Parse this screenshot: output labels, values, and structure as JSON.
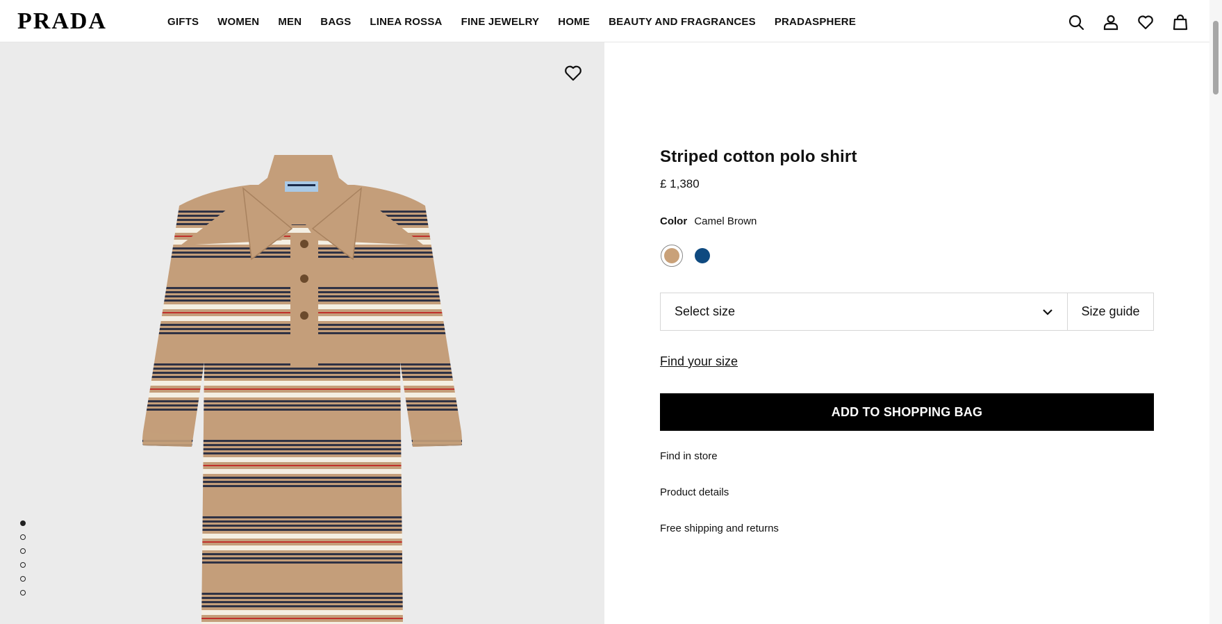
{
  "header": {
    "logo": "PRADA",
    "nav": [
      "GIFTS",
      "WOMEN",
      "MEN",
      "BAGS",
      "LINEA ROSSA",
      "FINE JEWELRY",
      "HOME",
      "BEAUTY AND FRAGRANCES",
      "PRADASPHERE"
    ],
    "icons": [
      "search-icon",
      "account-icon",
      "wishlist-icon",
      "shopping-bag-icon"
    ]
  },
  "gallery": {
    "image_count": 6,
    "active_index": 0
  },
  "product": {
    "title": "Striped cotton polo shirt",
    "price": "£ 1,380",
    "color_label": "Color",
    "color_value": "Camel Brown",
    "swatches": [
      {
        "name": "Camel Brown",
        "color": "#c9a179",
        "selected": true
      },
      {
        "name": "Blue",
        "color": "#0f4a80",
        "selected": false
      }
    ],
    "size_select": "Select size",
    "size_guide": "Size guide",
    "find_size": "Find your size",
    "add_to_bag": "ADD TO SHOPPING BAG",
    "links": [
      "Find in store",
      "Product details",
      "Free shipping and returns"
    ]
  },
  "colors": {
    "accent": "#000000",
    "image_bg": "#ebebeb",
    "shirt_camel": "#c49e7a",
    "stripe_navy": "#2f3244",
    "stripe_cream": "#f4efe3",
    "stripe_red": "#c0302a"
  }
}
